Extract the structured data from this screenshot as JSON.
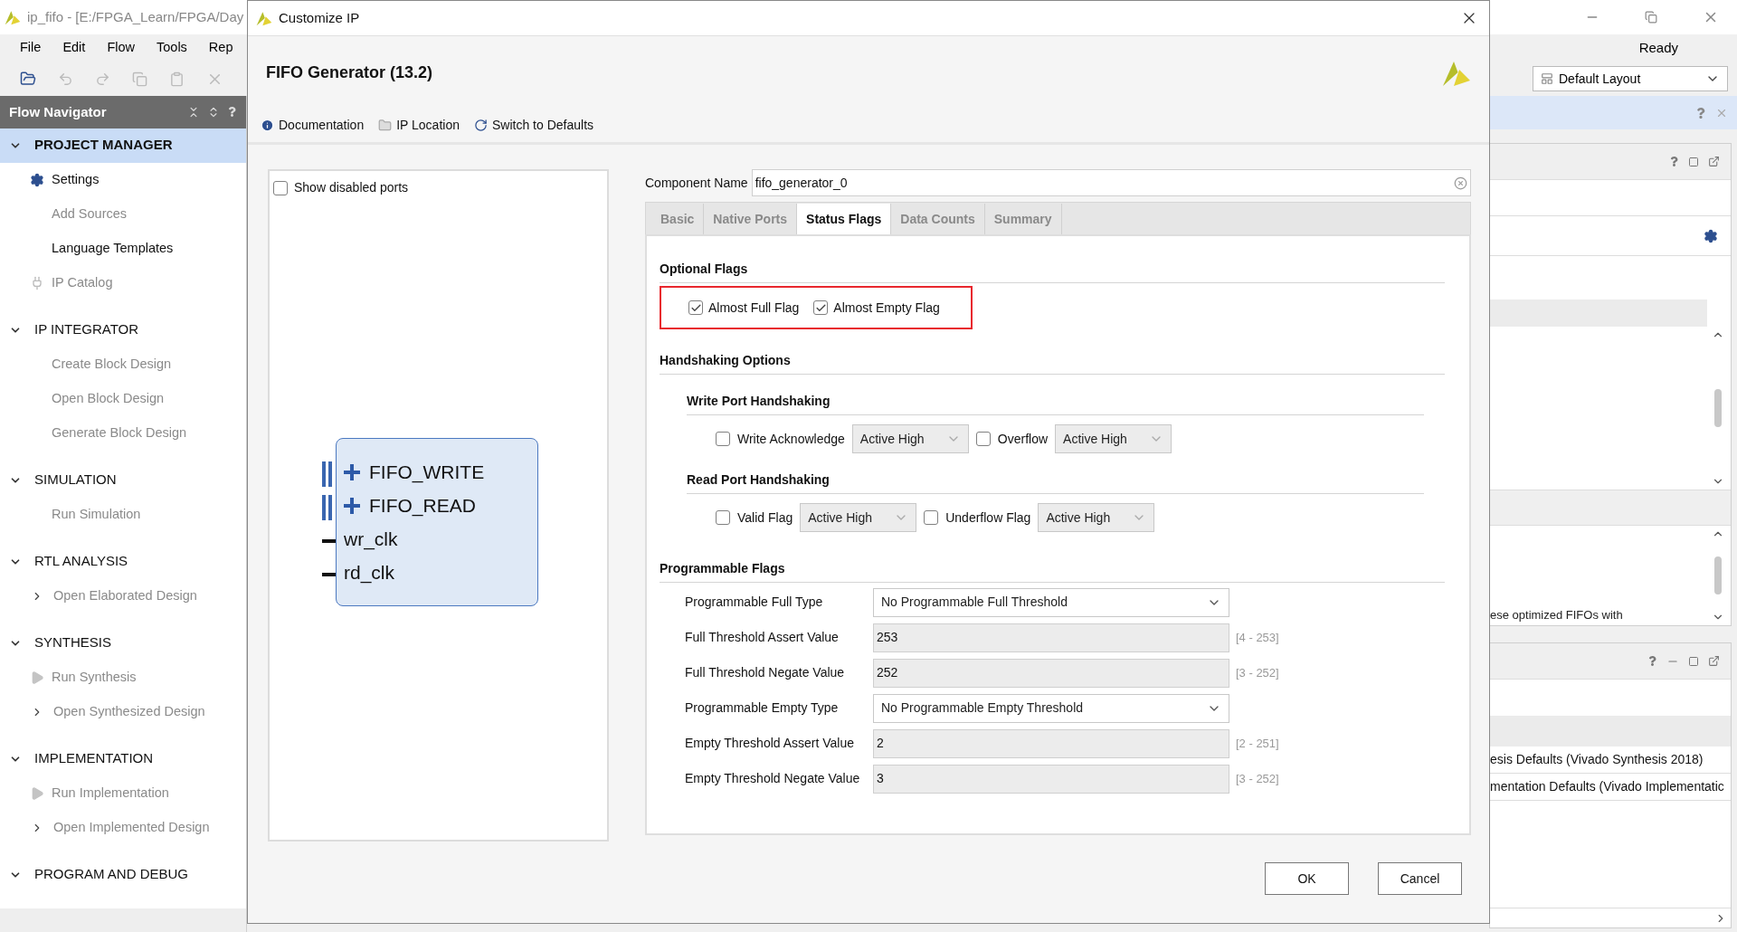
{
  "app": {
    "title": "ip_fifo - [E:/FPGA_Learn/FPGA/Day",
    "menu": [
      "File",
      "Edit",
      "Flow",
      "Tools",
      "Rep"
    ],
    "status": "Ready",
    "layout_select": "Default Layout"
  },
  "flow_navigator": {
    "title": "Flow Navigator",
    "sections": [
      {
        "label": "PROJECT MANAGER",
        "expanded": true,
        "selected": true,
        "items": [
          {
            "label": "Settings",
            "kind": "gear",
            "disabled": false
          },
          {
            "label": "Add Sources",
            "kind": "plain",
            "disabled": true
          },
          {
            "label": "Language Templates",
            "kind": "plain",
            "disabled": false
          },
          {
            "label": "IP Catalog",
            "kind": "plug",
            "disabled": true
          }
        ]
      },
      {
        "label": "IP INTEGRATOR",
        "expanded": true,
        "selected": false,
        "items": [
          {
            "label": "Create Block Design",
            "kind": "plain",
            "disabled": true
          },
          {
            "label": "Open Block Design",
            "kind": "plain",
            "disabled": true
          },
          {
            "label": "Generate Block Design",
            "kind": "plain",
            "disabled": true
          }
        ]
      },
      {
        "label": "SIMULATION",
        "expanded": true,
        "selected": false,
        "items": [
          {
            "label": "Run Simulation",
            "kind": "plain",
            "disabled": true
          }
        ]
      },
      {
        "label": "RTL ANALYSIS",
        "expanded": true,
        "selected": false,
        "items": [
          {
            "label": "Open Elaborated Design",
            "kind": "chevron",
            "disabled": true
          }
        ]
      },
      {
        "label": "SYNTHESIS",
        "expanded": true,
        "selected": false,
        "items": [
          {
            "label": "Run Synthesis",
            "kind": "play",
            "disabled": true
          },
          {
            "label": "Open Synthesized Design",
            "kind": "chevron",
            "disabled": true
          }
        ]
      },
      {
        "label": "IMPLEMENTATION",
        "expanded": true,
        "selected": false,
        "items": [
          {
            "label": "Run Implementation",
            "kind": "play",
            "disabled": true
          },
          {
            "label": "Open Implemented Design",
            "kind": "chevron",
            "disabled": true
          }
        ]
      },
      {
        "label": "PROGRAM AND DEBUG",
        "expanded": true,
        "selected": false
      }
    ]
  },
  "right_panels": {
    "message_text": "ese optimized FIFOs with",
    "rows": [
      "esis Defaults (Vivado Synthesis 2018)",
      "mentation Defaults (Vivado Implementatic"
    ]
  },
  "dialog": {
    "title": "Customize IP",
    "heading": "FIFO Generator (13.2)",
    "links": [
      {
        "label": "Documentation",
        "kind": "info"
      },
      {
        "label": "IP Location",
        "kind": "folder"
      },
      {
        "label": "Switch to Defaults",
        "kind": "reset"
      }
    ],
    "show_disabled_ports": {
      "label": "Show disabled ports",
      "checked": false
    },
    "symbol": {
      "ports": [
        {
          "name": "FIFO_WRITE",
          "kind": "bus"
        },
        {
          "name": "FIFO_READ",
          "kind": "bus"
        },
        {
          "name": "wr_clk",
          "kind": "wire"
        },
        {
          "name": "rd_clk",
          "kind": "wire"
        }
      ]
    },
    "component_name": {
      "label": "Component Name",
      "value": "fifo_generator_0"
    },
    "tabs": [
      {
        "label": "Basic",
        "selected": false
      },
      {
        "label": "Native Ports",
        "selected": false
      },
      {
        "label": "Status Flags",
        "selected": true
      },
      {
        "label": "Data Counts",
        "selected": false
      },
      {
        "label": "Summary",
        "selected": false
      }
    ],
    "optional_flags": {
      "title": "Optional Flags",
      "highlighted": true,
      "flags": [
        {
          "label": "Almost Full Flag",
          "checked": true
        },
        {
          "label": "Almost Empty Flag",
          "checked": true
        }
      ]
    },
    "handshaking": {
      "title": "Handshaking Options",
      "groups": [
        {
          "title": "Write Port Handshaking",
          "options": [
            {
              "label": "Write Acknowledge",
              "checked": false,
              "polarity": "Active High",
              "disabled": true
            },
            {
              "label": "Overflow",
              "checked": false,
              "polarity": "Active High",
              "disabled": true
            }
          ]
        },
        {
          "title": "Read Port Handshaking",
          "options": [
            {
              "label": "Valid Flag",
              "checked": false,
              "polarity": "Active High",
              "disabled": true
            },
            {
              "label": "Underflow Flag",
              "checked": false,
              "polarity": "Active High",
              "disabled": true
            }
          ]
        }
      ]
    },
    "programmable_flags": {
      "title": "Programmable Flags",
      "rows": [
        {
          "label": "Programmable Full Type",
          "kind": "select",
          "value": "No Programmable Full Threshold"
        },
        {
          "label": "Full Threshold Assert Value",
          "kind": "input",
          "value": "253",
          "disabled": true,
          "range": "[4 - 253]"
        },
        {
          "label": "Full Threshold Negate Value",
          "kind": "input",
          "value": "252",
          "disabled": true,
          "range": "[3 - 252]"
        },
        {
          "label": "Programmable Empty Type",
          "kind": "select",
          "value": "No Programmable Empty Threshold"
        },
        {
          "label": "Empty Threshold Assert Value",
          "kind": "input",
          "value": "2",
          "disabled": true,
          "range": "[2 - 251]"
        },
        {
          "label": "Empty Threshold Negate Value",
          "kind": "input",
          "value": "3",
          "disabled": true,
          "range": "[3 - 252]"
        }
      ]
    },
    "buttons": [
      {
        "label": "OK"
      },
      {
        "label": "Cancel"
      }
    ]
  }
}
